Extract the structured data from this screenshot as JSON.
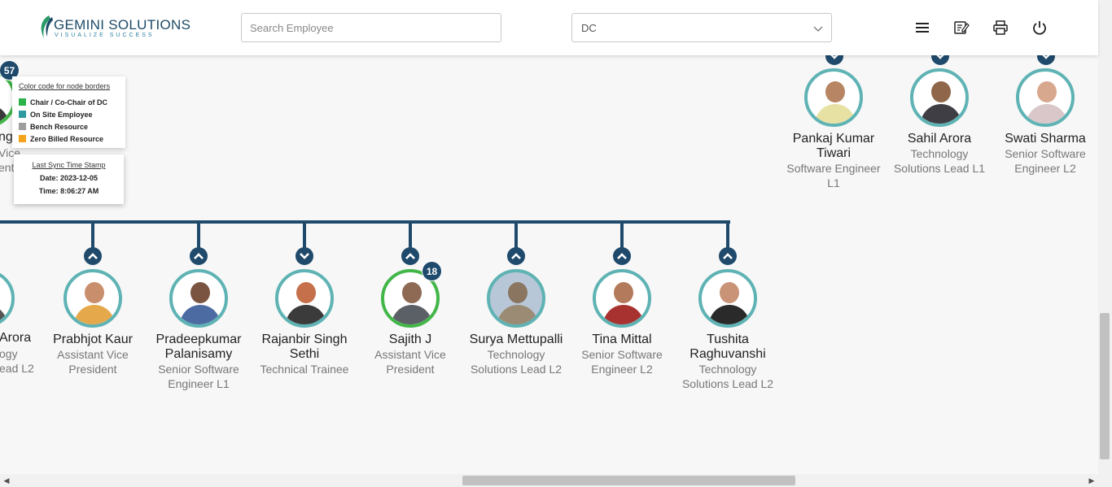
{
  "header": {
    "logo_main": "GEMINI SOLUTIONS",
    "logo_tagline": "VISUALIZE SUCCESS",
    "search_placeholder": "Search Employee",
    "dept_selected": "DC",
    "icons": [
      "menu-icon",
      "note-edit-icon",
      "print-icon",
      "power-icon"
    ]
  },
  "legend": {
    "title": "Color code for node borders",
    "items": [
      {
        "label": "Chair / Co-Chair of DC",
        "color": "#2bb34a"
      },
      {
        "label": "On Site Employee",
        "color": "#2e9aa0"
      },
      {
        "label": "Bench Resource",
        "color": "#9e9e9e"
      },
      {
        "label": "Zero Billed Resource",
        "color": "#f5a31a"
      }
    ]
  },
  "sync": {
    "title": "Last Sync Time Stamp",
    "date": "Date: 2023-12-05",
    "time": "Time: 8:06:27 AM"
  },
  "top_partial_node": {
    "name_fragment": "ng",
    "title_fragment_1": "Vice",
    "title_fragment_2": "ent",
    "badge": "57"
  },
  "top_right_nodes": [
    {
      "name": "Pankaj Kumar Tiwari",
      "title": "Software Engineer L1"
    },
    {
      "name": "Sahil Arora",
      "title": "Technology Solutions Lead L1"
    },
    {
      "name": "Swati Sharma",
      "title": "Senior Software Engineer L2"
    }
  ],
  "bottom_partial_node": {
    "name_fragment": "Arora",
    "title_fragment_1": "ogy",
    "title_fragment_2": "ead L2"
  },
  "bottom_nodes": [
    {
      "name": "Prabhjot Kaur",
      "title": "Assistant Vice President"
    },
    {
      "name": "Pradeepkumar Palanisamy",
      "title": "Senior Software Engineer L1"
    },
    {
      "name": "Rajanbir Singh Sethi",
      "title": "Technical Trainee"
    },
    {
      "name": "Sajith J",
      "title": "Assistant Vice President",
      "badge": "18"
    },
    {
      "name": "Surya Mettupalli",
      "title": "Technology Solutions Lead L2"
    },
    {
      "name": "Tina Mittal",
      "title": "Senior Software Engineer L2"
    },
    {
      "name": "Tushita Raghuvanshi",
      "title": "Technology Solutions Lead L2"
    }
  ],
  "colors": {
    "connector": "#1f4a6c",
    "onsite_border": "#5fb3b4",
    "chair_border": "#43b649"
  }
}
